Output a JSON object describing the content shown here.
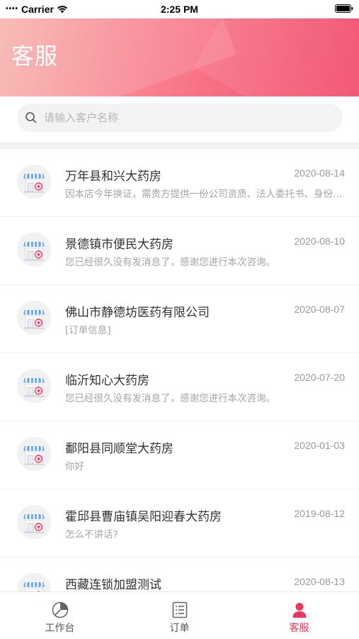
{
  "status_bar": {
    "carrier": "Carrier",
    "time": "2:25 PM"
  },
  "header": {
    "title": "客服"
  },
  "search": {
    "placeholder": "请输入客户名称",
    "value": ""
  },
  "conversations": [
    {
      "name": "万年县和兴大药房",
      "date": "2020-08-14",
      "message": "因本店今年换证，需贵方提供一份公司资质、法人委托书、身份证复印件"
    },
    {
      "name": "景德镇市便民大药房",
      "date": "2020-08-10",
      "message": "您已经很久没有发消息了，感谢您进行本次咨询。"
    },
    {
      "name": "佛山市静德坊医药有限公司",
      "date": "2020-08-07",
      "message": "[订单信息]"
    },
    {
      "name": "临沂知心大药房",
      "date": "2020-07-20",
      "message": "您已经很久没有发消息了，感谢您进行本次咨询。"
    },
    {
      "name": "鄱阳县同顺堂大药房",
      "date": "2020-01-03",
      "message": "你好"
    },
    {
      "name": "霍邱县曹庙镇吴阳迎春大药房",
      "date": "2019-08-12",
      "message": "怎么不讲话?"
    },
    {
      "name": "西藏连锁加盟测试",
      "date": "2020-08-13",
      "message": ""
    }
  ],
  "tabbar": {
    "items": [
      {
        "label": "工作台",
        "icon": "dashboard-icon"
      },
      {
        "label": "订单",
        "icon": "order-list-icon"
      },
      {
        "label": "客服",
        "icon": "customer-service-icon"
      }
    ],
    "active_index": 2
  },
  "colors": {
    "accent": "#f0345e",
    "header_gradient_start": "#f6b3ad",
    "header_gradient_end": "#f24b6c"
  }
}
